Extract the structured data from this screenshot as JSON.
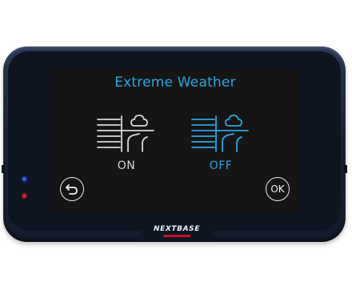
{
  "screen": {
    "title": "Extreme Weather",
    "options": [
      {
        "label": "ON",
        "icon": "extreme-weather-icon",
        "color": "#d8d8d8"
      },
      {
        "label": "OFF",
        "icon": "extreme-weather-icon",
        "color": "#2aa6e0",
        "selected": true
      }
    ],
    "back_icon": "back-arrow-icon",
    "ok_label": "OK"
  },
  "device": {
    "brand": "NEXTBASE",
    "status_lights": [
      "blue",
      "red"
    ]
  },
  "colors": {
    "accent": "#2aa6e0",
    "inactive": "#d8d8d8",
    "screen_bg": "#151515",
    "brand_red": "#c8102e"
  }
}
